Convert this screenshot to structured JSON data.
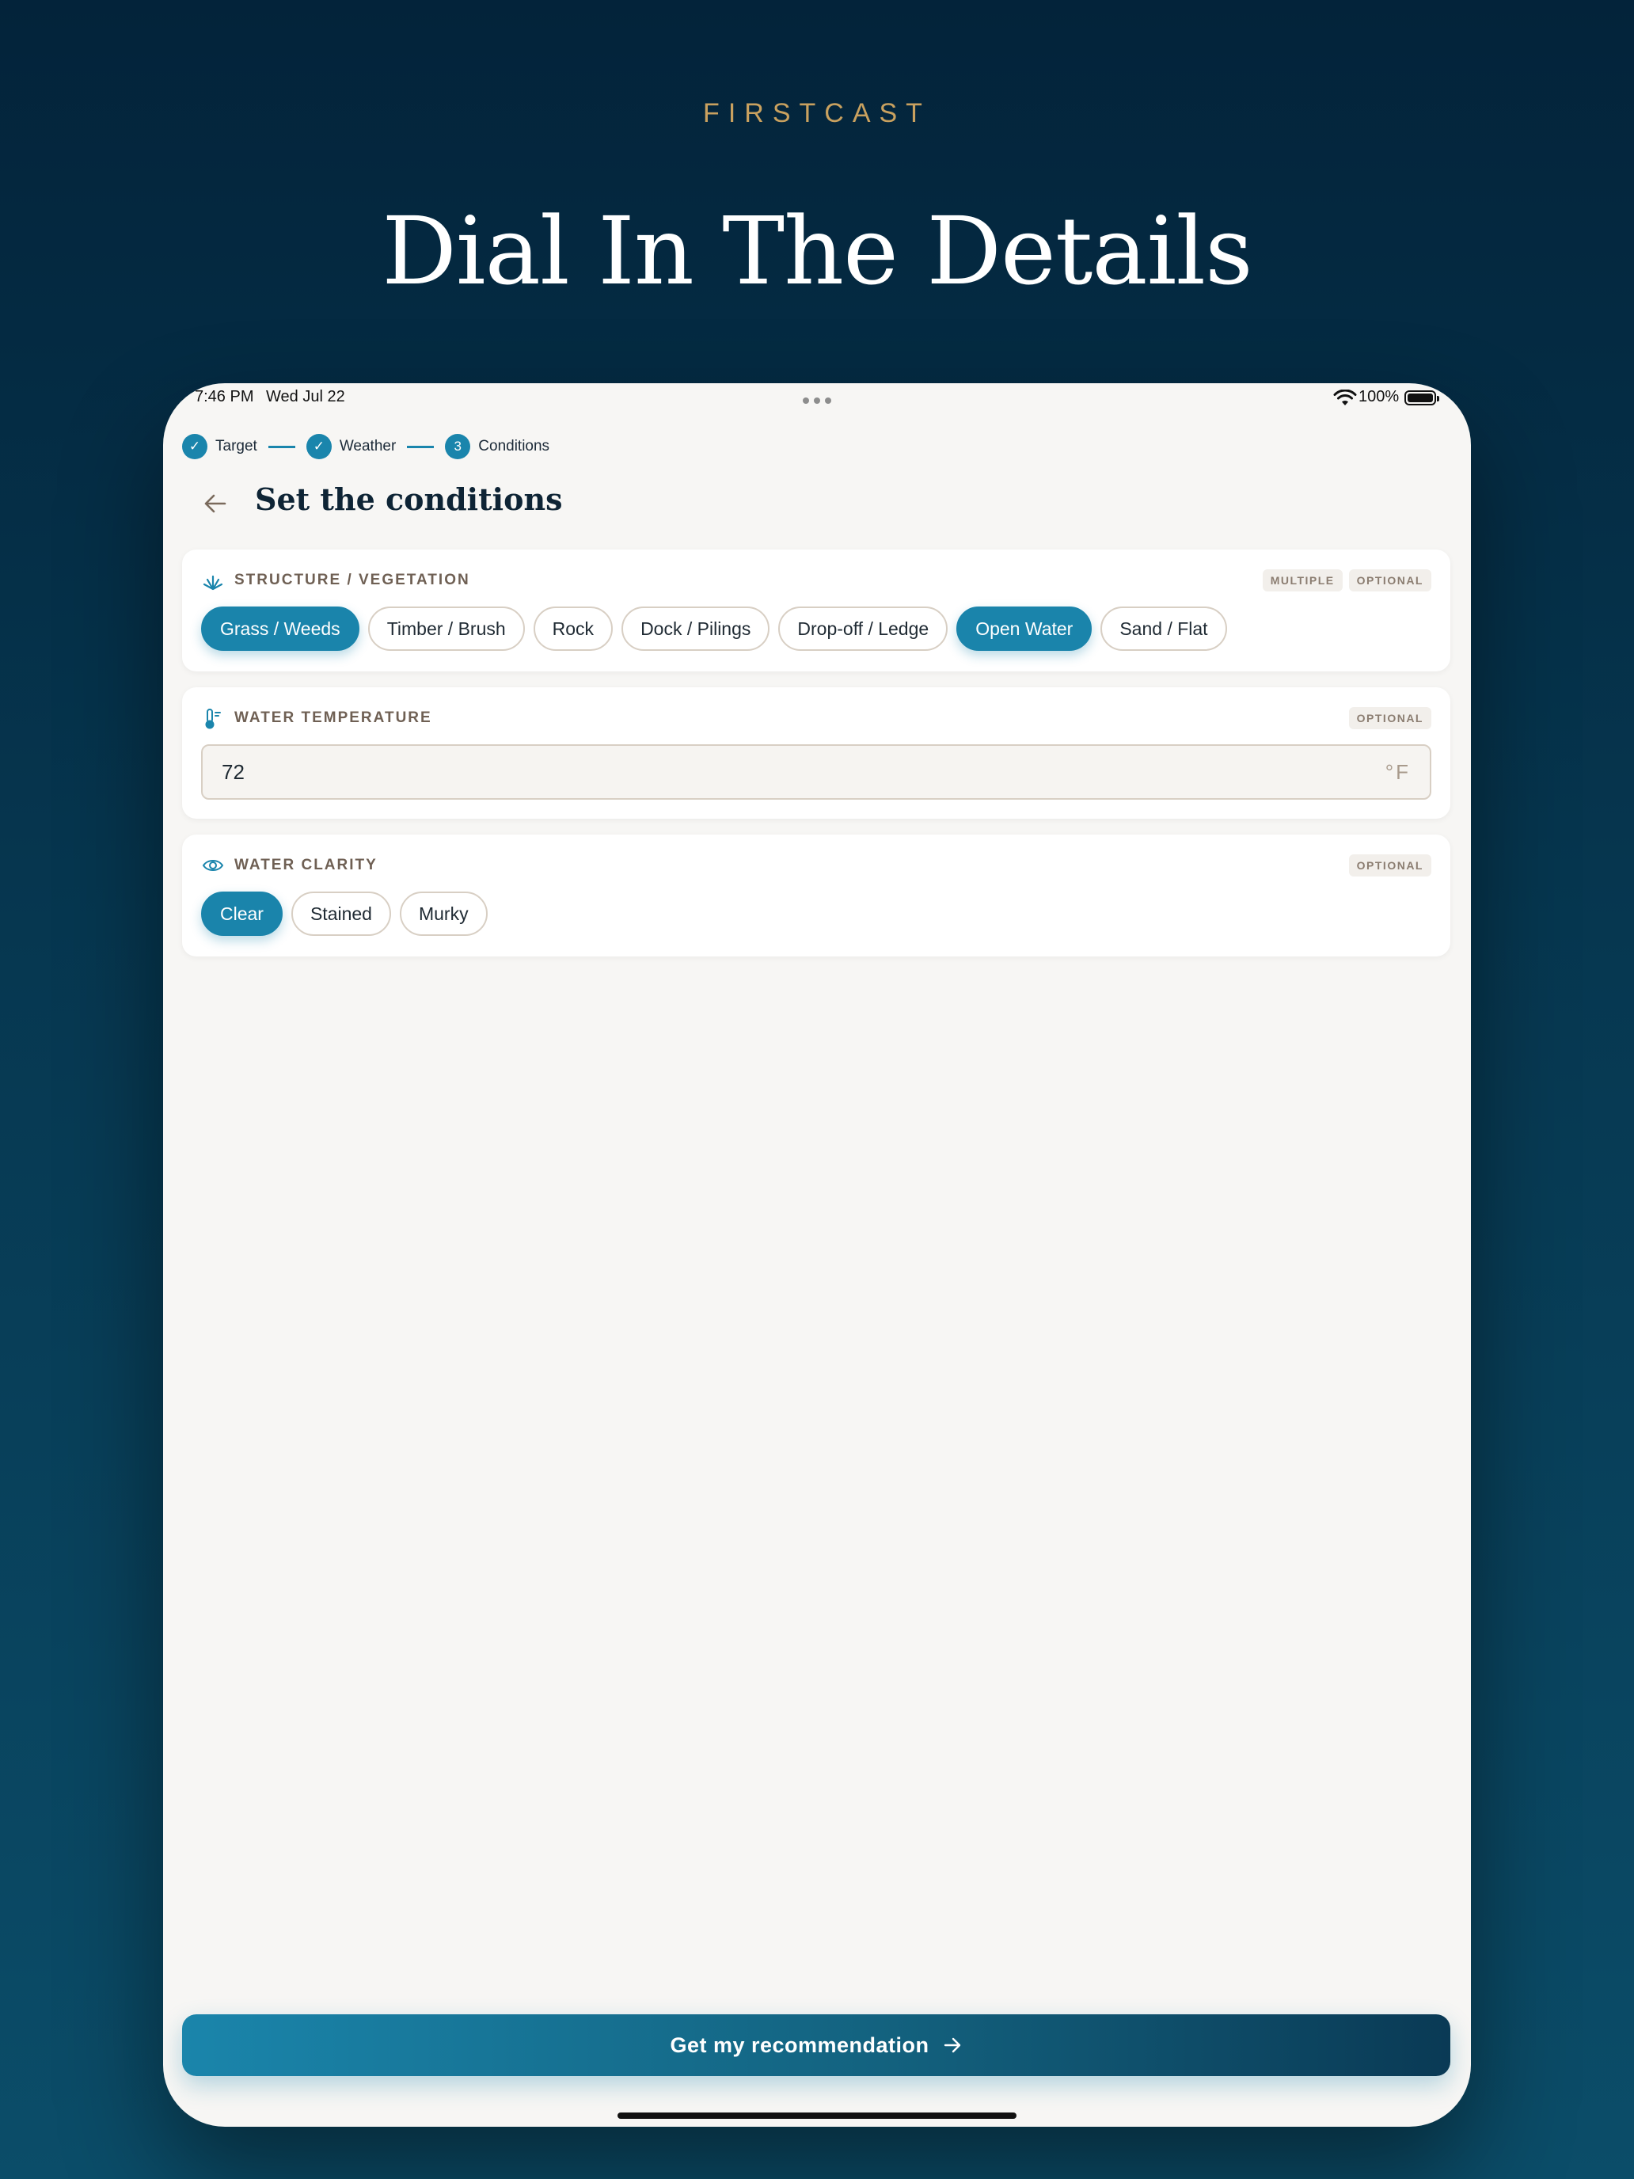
{
  "brand": "FIRSTCAST",
  "hero_title": "Dial In The Details",
  "status_bar": {
    "time": "7:46 PM",
    "date": "Wed Jul 22",
    "battery": "100%"
  },
  "stepper": {
    "steps": [
      {
        "label": "Target",
        "state": "done",
        "marker": "✓"
      },
      {
        "label": "Weather",
        "state": "done",
        "marker": "✓"
      },
      {
        "label": "Conditions",
        "state": "current",
        "marker": "3"
      }
    ]
  },
  "page_title": "Set the conditions",
  "structure": {
    "title": "STRUCTURE / VEGETATION",
    "tags": [
      "MULTIPLE",
      "OPTIONAL"
    ],
    "options": [
      {
        "label": "Grass / Weeds",
        "selected": true
      },
      {
        "label": "Timber / Brush",
        "selected": false
      },
      {
        "label": "Rock",
        "selected": false
      },
      {
        "label": "Dock / Pilings",
        "selected": false
      },
      {
        "label": "Drop-off / Ledge",
        "selected": false
      },
      {
        "label": "Open Water",
        "selected": true
      },
      {
        "label": "Sand / Flat",
        "selected": false
      }
    ]
  },
  "water_temperature": {
    "title": "WATER TEMPERATURE",
    "tag": "OPTIONAL",
    "value": "72",
    "unit": "°F"
  },
  "water_clarity": {
    "title": "WATER CLARITY",
    "tag": "OPTIONAL",
    "options": [
      {
        "label": "Clear",
        "selected": true
      },
      {
        "label": "Stained",
        "selected": false
      },
      {
        "label": "Murky",
        "selected": false
      }
    ]
  },
  "cta": {
    "label": "Get my recommendation"
  },
  "colors": {
    "accent": "#1a85ac",
    "brand_gold": "#c9a15f",
    "background_dark": "#03233a",
    "surface": "#f7f6f4"
  }
}
